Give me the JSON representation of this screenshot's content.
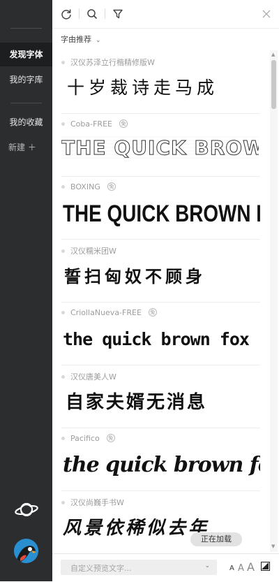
{
  "sidebar": {
    "items": [
      {
        "label": "发现字体",
        "active": true
      },
      {
        "label": "我的字库",
        "active": false
      },
      {
        "label": "我的收藏",
        "active": false
      }
    ],
    "new_label": "新建 ＋"
  },
  "toolbar": {
    "refresh_icon": "refresh-icon",
    "search_icon": "search-icon",
    "filter_icon": "filter-icon",
    "close_icon": "close-icon"
  },
  "sort": {
    "label": "字由推荐",
    "chevron": "⌄"
  },
  "fonts": [
    {
      "name": "汉仪苏泽立行楷精修版W",
      "free": false,
      "sample": "十岁裁诗走马成"
    },
    {
      "name": "Coba-FREE",
      "free": true,
      "sample": "THE QUICK BROWN FOX"
    },
    {
      "name": "BOXING",
      "free": true,
      "sample": "THE QUICK BROWN FOX"
    },
    {
      "name": "汉仪糯米团W",
      "free": false,
      "sample": "誓扫匈奴不顾身"
    },
    {
      "name": "CriollaNueva-FREE",
      "free": true,
      "sample": "the quick brown fox"
    },
    {
      "name": "汉仪唐美人W",
      "free": false,
      "sample": "自家夫婿无消息"
    },
    {
      "name": "Pacifico",
      "free": true,
      "sample": "the quick brown fox"
    },
    {
      "name": "汉仪尚巍手书W",
      "free": false,
      "sample": "风景依稀似去年"
    }
  ],
  "free_badge": "免",
  "loading_text": "正在加载",
  "bottom": {
    "preview_placeholder": "自定义预览文字...",
    "dropdown_icon": "chevron-down-icon",
    "font_sizes": [
      "A",
      "A",
      "A"
    ],
    "contrast_icon": "contrast-icon"
  },
  "colors": {
    "sidebar": "#2b2d2f",
    "sidebar_active": "#1d1e20",
    "muted_text": "#9c9c9c"
  }
}
